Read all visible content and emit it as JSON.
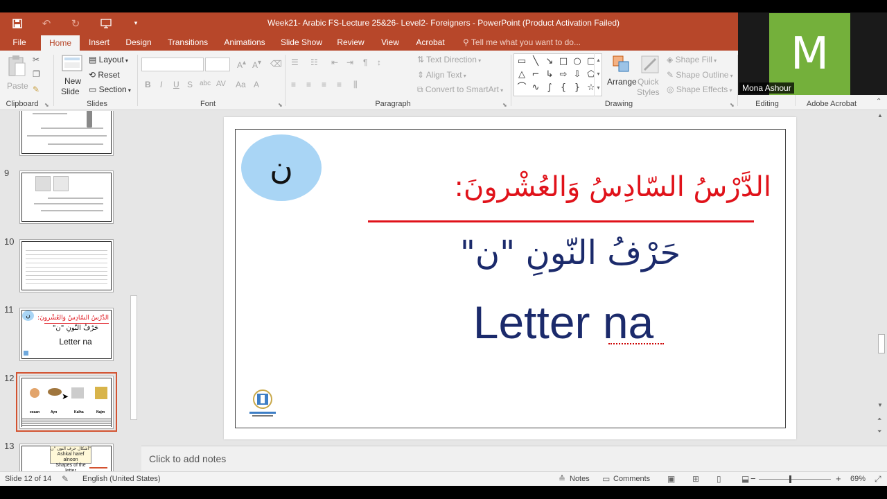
{
  "window": {
    "title": "Week21- Arabic FS-Lecture 25&26- Level2- Foreigners - PowerPoint (Product Activation Failed)"
  },
  "tabs": {
    "file": "File",
    "home": "Home",
    "insert": "Insert",
    "design": "Design",
    "transitions": "Transitions",
    "animations": "Animations",
    "slide_show": "Slide Show",
    "review": "Review",
    "view": "View",
    "acrobat": "Acrobat",
    "tell_me": "Tell me what you want to do..."
  },
  "ribbon": {
    "clipboard": {
      "label": "Clipboard",
      "paste": "Paste"
    },
    "slides": {
      "label": "Slides",
      "new_slide_1": "New",
      "new_slide_2": "Slide",
      "layout": "Layout",
      "reset": "Reset",
      "section": "Section"
    },
    "font": {
      "label": "Font"
    },
    "paragraph": {
      "label": "Paragraph",
      "text_direction": "Text Direction",
      "align_text": "Align Text",
      "convert_smartart": "Convert to SmartArt"
    },
    "drawing": {
      "label": "Drawing",
      "arrange": "Arrange",
      "quick_styles_1": "Quick",
      "quick_styles_2": "Styles",
      "shape_fill": "Shape Fill",
      "shape_outline": "Shape Outline",
      "shape_effects": "Shape Effects"
    },
    "editing": {
      "label": "Editing"
    },
    "adobe": {
      "label": "Adobe Acrobat"
    }
  },
  "video": {
    "initial": "M",
    "name": "Mona Ashour",
    "color": "#74b03b"
  },
  "thumbnails": {
    "numbers": [
      "9",
      "10",
      "11",
      "12",
      "13"
    ],
    "slide11": {
      "letter": "ن",
      "title": "الدَّرْسُ السّادِسُ وَالعُشْرونَ:",
      "sub": "حَرْفُ النّونِ \"ن\"",
      "en": "Letter na"
    },
    "slide12": {
      "words": [
        "eeaan",
        "Ayn",
        "Kalha",
        "Najm"
      ]
    },
    "slide13": {
      "box1": "أشكال حرف النون \"ن\"",
      "box2": "Ashkal haref alnoon",
      "box3": "Shapes of the letter"
    }
  },
  "slide": {
    "letter": "ن",
    "title_ar": "الدَّرْسُ السّادِسُ وَالعُشْرونَ:",
    "subtitle_ar": "حَرْفُ النّونِ \"ن\"",
    "subtitle_en": "Letter na",
    "title_color": "#e0121a",
    "text_color": "#1b2a6b",
    "circle_color": "#a9d5f5"
  },
  "notes": {
    "placeholder": "Click to add notes"
  },
  "status": {
    "slide_count": "Slide 12 of 14",
    "language": "English (United States)",
    "notes": "Notes",
    "comments": "Comments",
    "zoom": "69%"
  }
}
